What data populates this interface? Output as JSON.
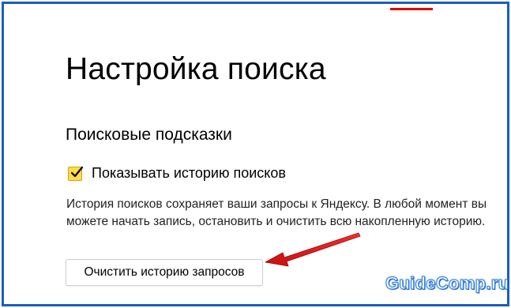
{
  "page": {
    "title": "Настройка поиска"
  },
  "section": {
    "title": "Поисковые подсказки",
    "checkbox_label": "Показывать историю поисков",
    "checkbox_checked": true,
    "description": "История поисков сохраняет ваши запросы к Яндексу. В любой момент вы можете начать запись, остановить и очистить всю накопленную историю.",
    "clear_button_label": "Очистить историю запросов"
  },
  "watermark": {
    "text": "GuideComp.ru"
  },
  "colors": {
    "frame": "#1a5fc4",
    "checkbox_fill": "#ffdb4d",
    "arrow": "#e02020",
    "accent_tab": "#e60000"
  },
  "icons": {
    "checkbox": "checkmark-icon",
    "annotation": "red-arrow-icon"
  }
}
